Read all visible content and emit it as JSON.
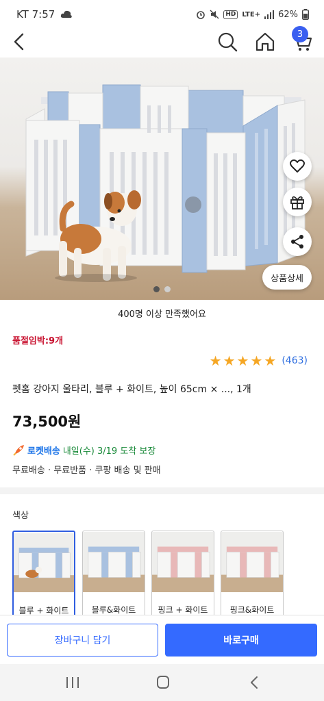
{
  "status": {
    "carrier_time": "KT 7:57",
    "network": "LTE+",
    "battery": "62%",
    "hd": "HD"
  },
  "header": {
    "cart_count": "3"
  },
  "hero": {
    "detail_button": "상품상세",
    "active_slide": 1,
    "total_slides": 2
  },
  "satisfaction": "400명 이상 만족했어요",
  "urgency": "품절임박:9개",
  "rating": {
    "stars": 5,
    "count": "(463)",
    "star_color": "#f5a623"
  },
  "product": {
    "title": "펫홈 강아지 울타리, 블루 + 화이트, 높이 65cm × ..., 1개",
    "price": "73,500원"
  },
  "delivery": {
    "rocket_label": "로켓배송",
    "arrival": "내일(수) 3/19 도착 보장",
    "info": "무료배송 · 무료반품 · 쿠팡 배송 및 판매"
  },
  "options": {
    "label": "색상",
    "items": [
      {
        "label": "블루 + 화이트",
        "theme": "blue",
        "selected": true
      },
      {
        "label": "블루&화이트",
        "theme": "blue",
        "selected": false
      },
      {
        "label": "핑크 + 화이트",
        "theme": "pink",
        "selected": false
      },
      {
        "label": "핑크&화이트",
        "theme": "pink",
        "selected": false
      }
    ]
  },
  "actions": {
    "cart": "장바구니 담기",
    "buy": "바로구매"
  },
  "colors": {
    "accent": "#346aff",
    "urgency": "#c8102e",
    "rocket": "#1a73e8",
    "arrival": "#1a8a3a"
  }
}
